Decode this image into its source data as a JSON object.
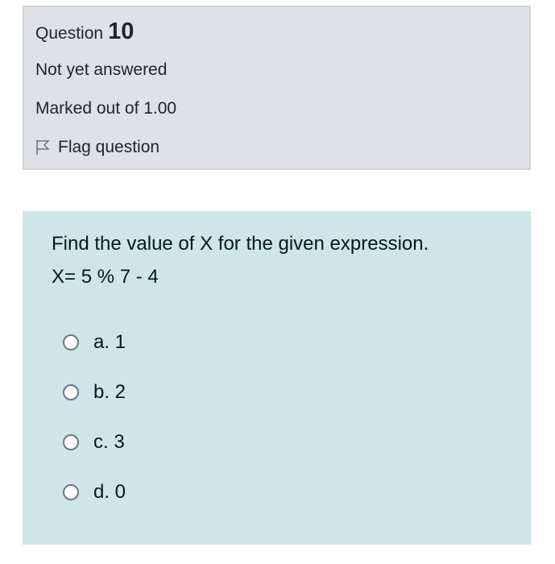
{
  "question_info": {
    "title_prefix": "Question",
    "number": "10",
    "state": "Not yet answered",
    "grade": "Marked out of 1.00",
    "flag_label": "Flag question",
    "flag_icon": "flag-outline-icon"
  },
  "formulation": {
    "text_line1": "Find the value of X for the given expression.",
    "text_line2": "X= 5 % 7 - 4",
    "answers": [
      {
        "label": "a. 1",
        "selected": false
      },
      {
        "label": "b. 2",
        "selected": false
      },
      {
        "label": "c. 3",
        "selected": false
      },
      {
        "label": "d. 0",
        "selected": false
      }
    ]
  },
  "colors": {
    "info_background": "#dee2e6",
    "info_border": "#ced4da",
    "formulation_background": "#cee5ea",
    "formulation_text": "#001a1e"
  }
}
